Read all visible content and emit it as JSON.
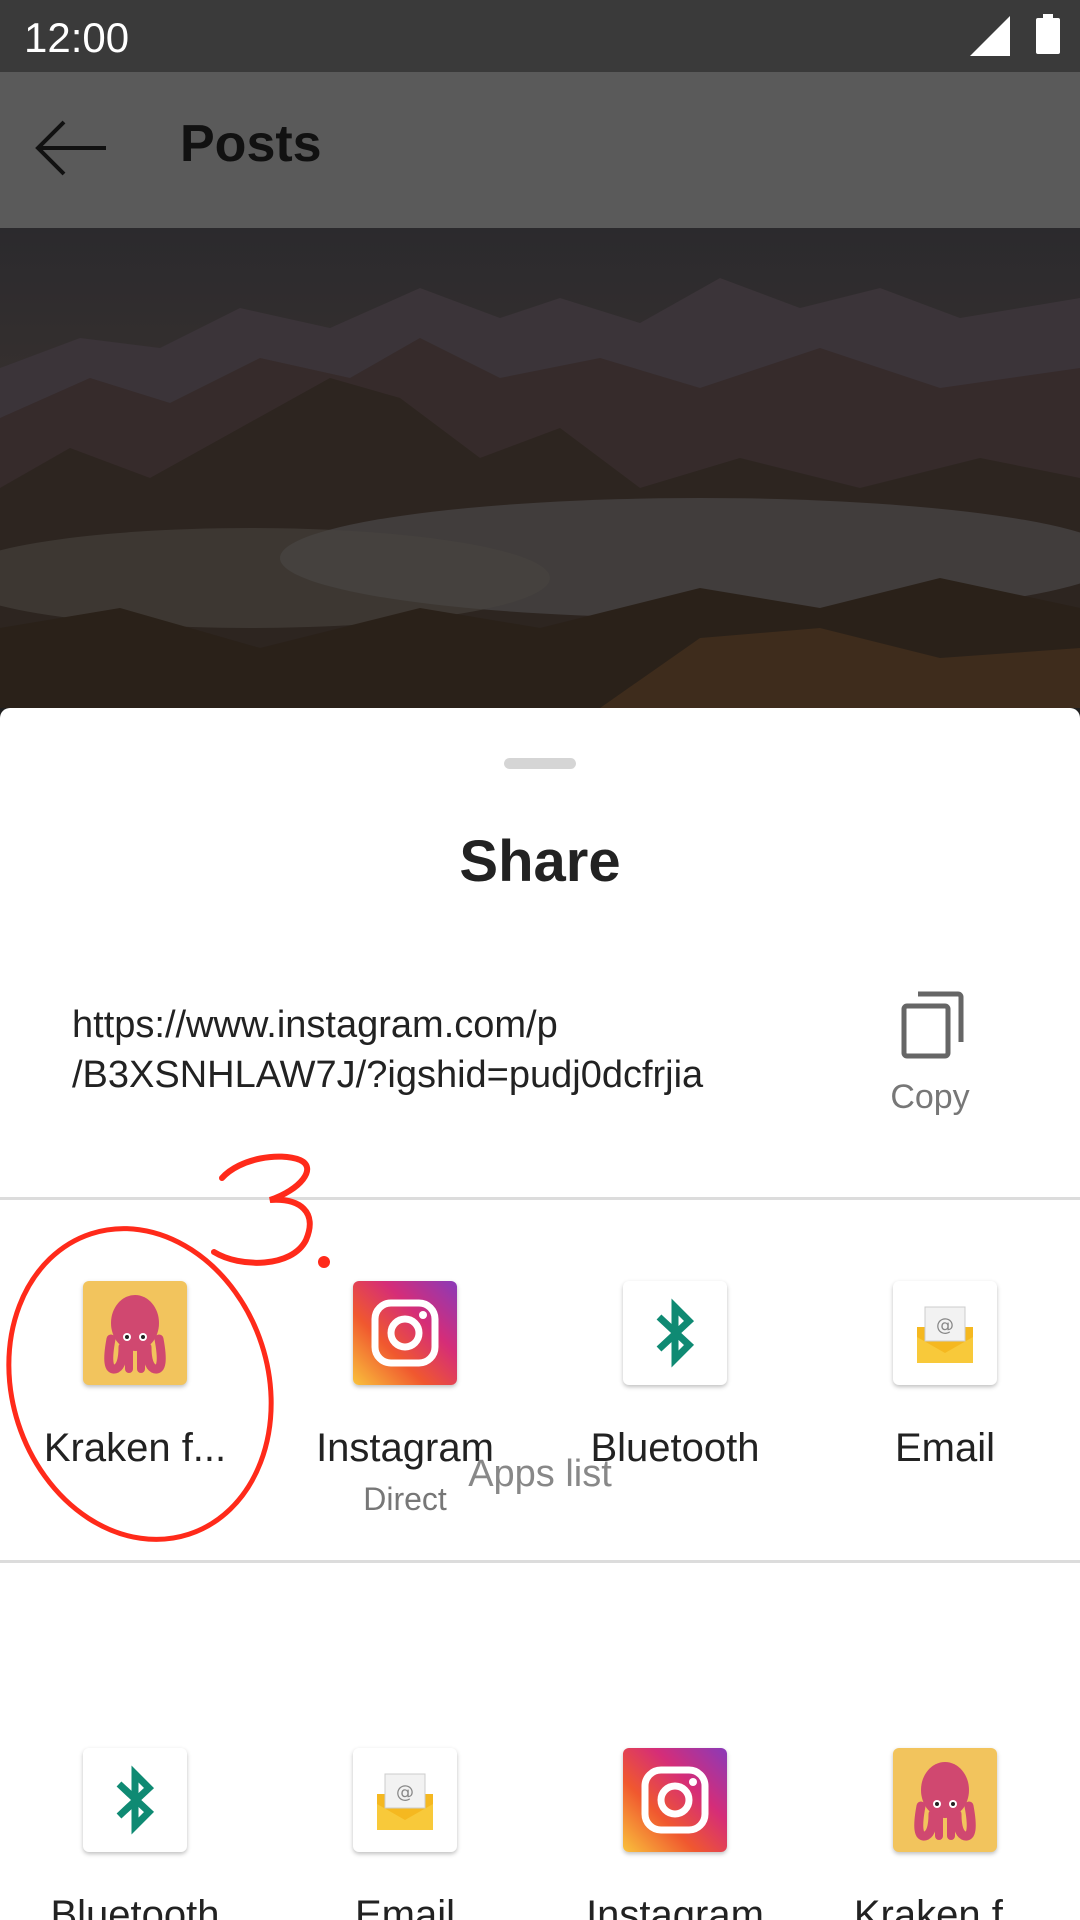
{
  "status_bar": {
    "time": "12:00"
  },
  "app_bar": {
    "title": "Posts"
  },
  "share_sheet": {
    "title": "Share",
    "url_line1": "https://www.instagram.com/p",
    "url_line2": "/B3XSNHLAW7J/?igshid=pudj0dcfrjia",
    "copy_label": "Copy",
    "direct_targets": [
      {
        "label": "Kraken f...",
        "icon": "kraken-icon"
      },
      {
        "label": "Instagram",
        "sub": "Direct",
        "icon": "instagram-icon"
      },
      {
        "label": "Bluetooth",
        "icon": "bluetooth-icon"
      },
      {
        "label": "Email",
        "icon": "email-icon"
      }
    ],
    "apps_list_label": "Apps list",
    "apps_list": [
      {
        "label": "Bluetooth",
        "icon": "bluetooth-icon"
      },
      {
        "label": "Email",
        "icon": "email-icon"
      },
      {
        "label": "Instagram",
        "icon": "instagram-icon"
      },
      {
        "label": "Kraken f...",
        "icon": "kraken-icon"
      }
    ]
  },
  "annotation": {
    "text": "3.",
    "color": "#ff2a1a"
  },
  "colors": {
    "bluetooth": "#0f8a73",
    "annotation_red": "#ff2a1a"
  }
}
